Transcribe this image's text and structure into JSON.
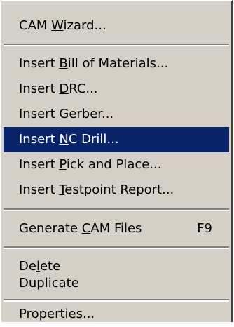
{
  "menu": {
    "items": [
      {
        "id": "cam-wizard",
        "pre": "CAM ",
        "mn": "W",
        "post": "izard...",
        "shortcut": ""
      },
      {
        "id": "insert-bom",
        "pre": "Insert ",
        "mn": "B",
        "post": "ill of Materials...",
        "shortcut": ""
      },
      {
        "id": "insert-drc",
        "pre": "Insert ",
        "mn": "D",
        "post": "RC...",
        "shortcut": ""
      },
      {
        "id": "insert-gerber",
        "pre": "Insert ",
        "mn": "G",
        "post": "erber...",
        "shortcut": ""
      },
      {
        "id": "insert-nc-drill",
        "pre": "Insert ",
        "mn": "N",
        "post": "C Drill...",
        "shortcut": "",
        "selected": true
      },
      {
        "id": "insert-pick-place",
        "pre": "Insert ",
        "mn": "P",
        "post": "ick and Place...",
        "shortcut": ""
      },
      {
        "id": "insert-testpoint",
        "pre": "Insert ",
        "mn": "T",
        "post": "estpoint Report...",
        "shortcut": ""
      },
      {
        "id": "generate-cam",
        "pre": "Generate ",
        "mn": "C",
        "post": "AM Files",
        "shortcut": "F9"
      },
      {
        "id": "delete",
        "pre": "De",
        "mn": "l",
        "post": "ete",
        "shortcut": ""
      },
      {
        "id": "duplicate",
        "pre": "D",
        "mn": "u",
        "post": "plicate",
        "shortcut": ""
      },
      {
        "id": "properties",
        "pre": "P",
        "mn": "r",
        "post": "operties...",
        "shortcut": ""
      }
    ]
  }
}
